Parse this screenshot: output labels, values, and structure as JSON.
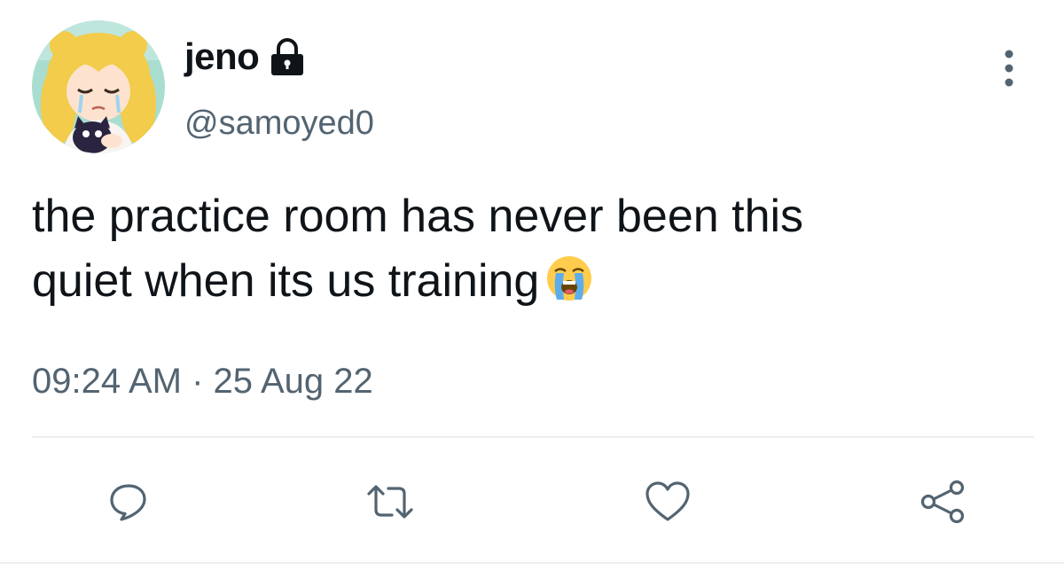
{
  "user": {
    "display_name": "jeno",
    "handle": "@samoyed0",
    "avatar_icon": "avatar-image",
    "lock_icon": "lock-icon"
  },
  "tweet": {
    "text_line_1": "the practice room has never been this",
    "text_line_2": "quiet when its us training",
    "emoji": "loudly-crying-face-emoji",
    "timestamp": "09:24 AM · 25 Aug 22"
  },
  "actions": {
    "reply_icon": "reply-icon",
    "retweet_icon": "retweet-icon",
    "like_icon": "heart-icon",
    "share_icon": "share-icon",
    "more_icon": "more-vertical-icon"
  },
  "colors": {
    "text": "#0f1419",
    "secondary": "#536471",
    "divider": "#eceff1"
  }
}
